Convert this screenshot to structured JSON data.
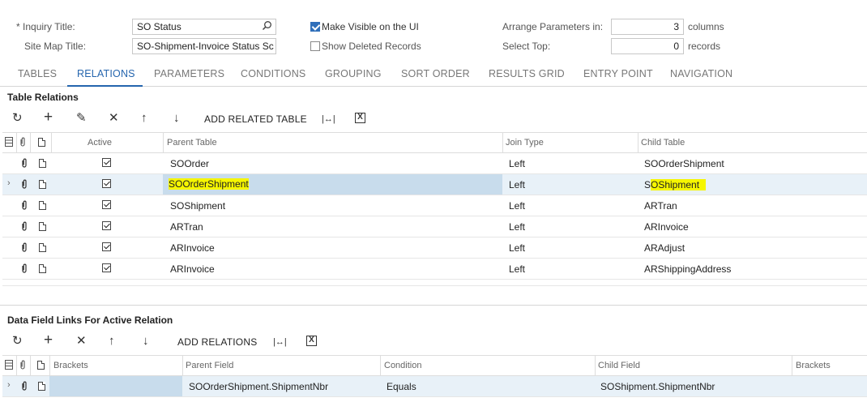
{
  "form": {
    "inquiry_title_label": "Inquiry Title:",
    "required_mark": "*",
    "inquiry_title_value": "SO Status",
    "site_map_title_label": "Site Map Title:",
    "site_map_title_value": "SO-Shipment-Invoice Status Sc",
    "make_visible_label": "Make Visible on the UI",
    "make_visible_checked": true,
    "show_deleted_label": "Show Deleted Records",
    "show_deleted_checked": false,
    "arrange_label": "Arrange Parameters in:",
    "arrange_value": "3",
    "arrange_unit": "columns",
    "select_top_label": "Select Top:",
    "select_top_value": "0",
    "select_top_unit": "records"
  },
  "tabs": [
    "TABLES",
    "RELATIONS",
    "PARAMETERS",
    "CONDITIONS",
    "GROUPING",
    "SORT ORDER",
    "RESULTS GRID",
    "ENTRY POINT",
    "NAVIGATION"
  ],
  "active_tab": "RELATIONS",
  "table_relations": {
    "title": "Table Relations",
    "toolbar": {
      "refresh": "↻",
      "add": "+",
      "edit": "✎",
      "delete": "✕",
      "up": "↑",
      "down": "↓",
      "add_related_table": "ADD RELATED TABLE",
      "fit": "|↔|",
      "export": "X"
    },
    "columns": [
      "Active",
      "Parent Table",
      "Join Type",
      "Child Table"
    ],
    "rows": [
      {
        "active": true,
        "parent": "SOOrder",
        "join": "Left",
        "child": "SOOrderShipment",
        "selected": false
      },
      {
        "active": true,
        "parent": "SOOrderShipment",
        "join": "Left",
        "child": "SOShipment",
        "selected": true
      },
      {
        "active": true,
        "parent": "SOShipment",
        "join": "Left",
        "child": "ARTran",
        "selected": false
      },
      {
        "active": true,
        "parent": "ARTran",
        "join": "Left",
        "child": "ARInvoice",
        "selected": false
      },
      {
        "active": true,
        "parent": "ARInvoice",
        "join": "Left",
        "child": "ARAdjust",
        "selected": false
      },
      {
        "active": true,
        "parent": "ARInvoice",
        "join": "Left",
        "child": "ARShippingAddress",
        "selected": false
      }
    ]
  },
  "data_field_links": {
    "title": "Data Field Links For Active Relation",
    "toolbar": {
      "refresh": "↻",
      "add": "+",
      "delete": "✕",
      "up": "↑",
      "down": "↓",
      "add_relations": "ADD RELATIONS",
      "fit": "|↔|",
      "export": "X"
    },
    "columns": [
      "Brackets",
      "Parent Field",
      "Condition",
      "Child Field",
      "Brackets"
    ],
    "rows": [
      {
        "brackets_open": "",
        "parent_field": "SOOrderShipment.ShipmentNbr",
        "condition": "Equals",
        "child_field": "SOShipment.ShipmentNbr",
        "brackets_close": ""
      }
    ]
  },
  "colors": {
    "accent": "#2565ae",
    "highlight": "#f6f600",
    "selected_row": "#e8f1f8",
    "selected_cell": "#c8dcec"
  }
}
